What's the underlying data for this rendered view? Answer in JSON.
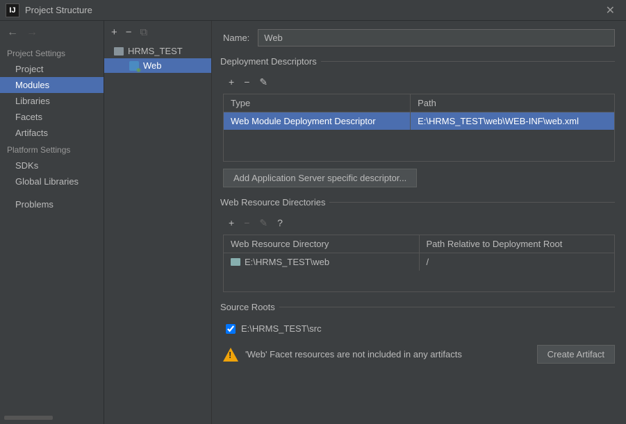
{
  "window": {
    "title": "Project Structure"
  },
  "sidebar": {
    "section1": "Project Settings",
    "items1": [
      "Project",
      "Modules",
      "Libraries",
      "Facets",
      "Artifacts"
    ],
    "section2": "Platform Settings",
    "items2": [
      "SDKs",
      "Global Libraries"
    ],
    "problems": "Problems"
  },
  "tree": {
    "root": "HRMS_TEST",
    "child": "Web"
  },
  "main": {
    "name_label": "Name:",
    "name_value": "Web",
    "desc": {
      "legend": "Deployment Descriptors",
      "col_type": "Type",
      "col_path": "Path",
      "row_type": "Web Module Deployment Descriptor",
      "row_path": "E:\\HRMS_TEST\\web\\WEB-INF\\web.xml",
      "add_btn": "Add Application Server specific descriptor..."
    },
    "res": {
      "legend": "Web Resource Directories",
      "col_dir": "Web Resource Directory",
      "col_path": "Path Relative to Deployment Root",
      "row_dir": "E:\\HRMS_TEST\\web",
      "row_path": "/"
    },
    "roots": {
      "legend": "Source Roots",
      "item": "E:\\HRMS_TEST\\src"
    },
    "warning": "'Web' Facet resources are not included in any artifacts",
    "create_artifact": "Create Artifact"
  }
}
